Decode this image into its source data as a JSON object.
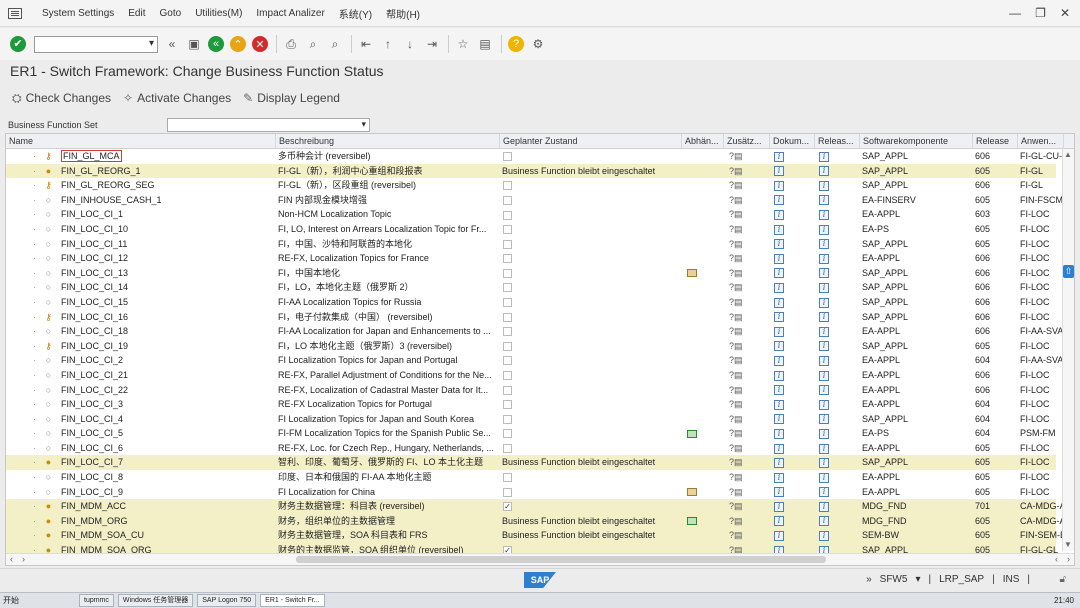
{
  "menu": {
    "items": [
      "System Settings",
      "Edit",
      "Goto",
      "Utilities(M)",
      "Impact Analizer",
      "系统(Y)",
      "帮助(H)"
    ]
  },
  "window_controls": [
    "—",
    "❐",
    "✕"
  ],
  "page_title": "ER1 - Switch Framework: Change Business Function Status",
  "app_toolbar": {
    "check_changes": "Check Changes",
    "activate_changes": "Activate Changes",
    "display_legend": "Display Legend"
  },
  "bfs": {
    "label": "Business Function Set",
    "value": ""
  },
  "columns": [
    "Name",
    "Beschreibung",
    "Geplanter Zustand",
    "Abhän...",
    "Zusätz...",
    "Dokum...",
    "Releas...",
    "Softwarekomponente",
    "Release",
    "Anwen..."
  ],
  "rows": [
    {
      "name": "FIN_GL_MCA",
      "status": "reversible",
      "desc": "多币种会计 (reversibel)",
      "state": "",
      "checked": false,
      "dep": "",
      "sw": "SAP_APPL",
      "release": "606",
      "appl": "FI-GL-CU-M",
      "hl": false,
      "selected": true
    },
    {
      "name": "FIN_GL_REORG_1",
      "status": "on",
      "desc": "FI-GL（新），利润中心重组和段报表",
      "state": "Business Function bleibt eingeschaltet",
      "checked": false,
      "dep": "",
      "sw": "SAP_APPL",
      "release": "605",
      "appl": "FI-GL",
      "hl": true
    },
    {
      "name": "FIN_GL_REORG_SEG",
      "status": "reversible",
      "desc": "FI-GL（新），区段重组 (reversibel)",
      "state": "",
      "checked": false,
      "dep": "",
      "sw": "SAP_APPL",
      "release": "606",
      "appl": "FI-GL",
      "hl": false
    },
    {
      "name": "FIN_INHOUSE_CASH_1",
      "status": "off",
      "desc": "FIN 内部现金模块增强",
      "state": "",
      "checked": false,
      "dep": "",
      "sw": "EA-FINSERV",
      "release": "605",
      "appl": "FIN-FSCM-",
      "hl": false
    },
    {
      "name": "FIN_LOC_CI_1",
      "status": "off",
      "desc": "Non-HCM Localization Topic",
      "state": "",
      "checked": false,
      "dep": "",
      "sw": "EA-APPL",
      "release": "603",
      "appl": "FI-LOC",
      "hl": false
    },
    {
      "name": "FIN_LOC_CI_10",
      "status": "off",
      "desc": "FI, LO, Interest on Arrears Localization Topic for Fr...",
      "state": "",
      "checked": false,
      "dep": "",
      "sw": "EA-PS",
      "release": "605",
      "appl": "FI-LOC",
      "hl": false
    },
    {
      "name": "FIN_LOC_CI_11",
      "status": "off",
      "desc": "FI，中国、沙特和阿联酋的本地化",
      "state": "",
      "checked": false,
      "dep": "",
      "sw": "SAP_APPL",
      "release": "605",
      "appl": "FI-LOC",
      "hl": false
    },
    {
      "name": "FIN_LOC_CI_12",
      "status": "off",
      "desc": "RE-FX, Localization Topics for France",
      "state": "",
      "checked": false,
      "dep": "",
      "sw": "EA-APPL",
      "release": "606",
      "appl": "FI-LOC",
      "hl": false
    },
    {
      "name": "FIN_LOC_CI_13",
      "status": "off",
      "desc": "FI，中国本地化",
      "state": "",
      "checked": false,
      "dep": "y",
      "sw": "SAP_APPL",
      "release": "606",
      "appl": "FI-LOC",
      "hl": false
    },
    {
      "name": "FIN_LOC_CI_14",
      "status": "off",
      "desc": "FI，LO，本地化主题（俄罗斯 2）",
      "state": "",
      "checked": false,
      "dep": "",
      "sw": "SAP_APPL",
      "release": "606",
      "appl": "FI-LOC",
      "hl": false
    },
    {
      "name": "FIN_LOC_CI_15",
      "status": "off",
      "desc": "FI-AA Localization Topics for Russia",
      "state": "",
      "checked": false,
      "dep": "",
      "sw": "SAP_APPL",
      "release": "606",
      "appl": "FI-LOC",
      "hl": false
    },
    {
      "name": "FIN_LOC_CI_16",
      "status": "reversible",
      "desc": "FI，电子付款集成（中国） (reversibel)",
      "state": "",
      "checked": false,
      "dep": "",
      "sw": "SAP_APPL",
      "release": "606",
      "appl": "FI-LOC",
      "hl": false
    },
    {
      "name": "FIN_LOC_CI_18",
      "status": "off",
      "desc": "FI-AA Localization for Japan and Enhancements to ...",
      "state": "",
      "checked": false,
      "dep": "",
      "sw": "EA-APPL",
      "release": "606",
      "appl": "FI-AA-SVA",
      "hl": false
    },
    {
      "name": "FIN_LOC_CI_19",
      "status": "reversible",
      "desc": "FI，LO 本地化主题（俄罗斯）3 (reversibel)",
      "state": "",
      "checked": false,
      "dep": "",
      "sw": "SAP_APPL",
      "release": "605",
      "appl": "FI-LOC",
      "hl": false
    },
    {
      "name": "FIN_LOC_CI_2",
      "status": "off",
      "desc": "FI Localization Topics for Japan and Portugal",
      "state": "",
      "checked": false,
      "dep": "",
      "sw": "EA-APPL",
      "release": "604",
      "appl": "FI-AA-SVA",
      "hl": false
    },
    {
      "name": "FIN_LOC_CI_21",
      "status": "off",
      "desc": "RE-FX, Parallel Adjustment of Conditions for the Ne...",
      "state": "",
      "checked": false,
      "dep": "",
      "sw": "EA-APPL",
      "release": "606",
      "appl": "FI-LOC",
      "hl": false
    },
    {
      "name": "FIN_LOC_CI_22",
      "status": "off",
      "desc": "RE-FX, Localization of Cadastral Master Data for It...",
      "state": "",
      "checked": false,
      "dep": "",
      "sw": "EA-APPL",
      "release": "606",
      "appl": "FI-LOC",
      "hl": false
    },
    {
      "name": "FIN_LOC_CI_3",
      "status": "off",
      "desc": "RE-FX Localization Topics for Portugal",
      "state": "",
      "checked": false,
      "dep": "",
      "sw": "EA-APPL",
      "release": "604",
      "appl": "FI-LOC",
      "hl": false
    },
    {
      "name": "FIN_LOC_CI_4",
      "status": "off",
      "desc": "FI Localization Topics for Japan and South Korea",
      "state": "",
      "checked": false,
      "dep": "",
      "sw": "SAP_APPL",
      "release": "604",
      "appl": "FI-LOC",
      "hl": false
    },
    {
      "name": "FIN_LOC_CI_5",
      "status": "off",
      "desc": "FI-FM Localization Topics for the Spanish Public Se...",
      "state": "",
      "checked": false,
      "dep": "g",
      "sw": "EA-PS",
      "release": "604",
      "appl": "PSM-FM",
      "hl": false
    },
    {
      "name": "FIN_LOC_CI_6",
      "status": "off",
      "desc": "RE-FX, Loc. for Czech Rep., Hungary, Netherlands, ...",
      "state": "",
      "checked": false,
      "dep": "",
      "sw": "EA-APPL",
      "release": "605",
      "appl": "FI-LOC",
      "hl": false
    },
    {
      "name": "FIN_LOC_CI_7",
      "status": "on",
      "desc": "智利、印度、葡萄牙、俄罗斯的 FI、LO 本土化主题",
      "state": "Business Function bleibt eingeschaltet",
      "checked": false,
      "dep": "",
      "sw": "SAP_APPL",
      "release": "605",
      "appl": "FI-LOC",
      "hl": true
    },
    {
      "name": "FIN_LOC_CI_8",
      "status": "off",
      "desc": "印度、日本和俄国的 FI-AA 本地化主题",
      "state": "",
      "checked": false,
      "dep": "",
      "sw": "EA-APPL",
      "release": "605",
      "appl": "FI-LOC",
      "hl": false
    },
    {
      "name": "FIN_LOC_CI_9",
      "status": "off",
      "desc": "FI Localization for China",
      "state": "",
      "checked": false,
      "dep": "y",
      "sw": "EA-APPL",
      "release": "605",
      "appl": "FI-LOC",
      "hl": false
    },
    {
      "name": "FIN_MDM_ACC",
      "status": "on",
      "desc": "财务主数据管理：科目表 (reversibel)",
      "state": "",
      "checked": true,
      "dep": "",
      "sw": "MDG_FND",
      "release": "701",
      "appl": "CA-MDG-A",
      "hl": true
    },
    {
      "name": "FIN_MDM_ORG",
      "status": "on",
      "desc": "财务，组织单位的主数据管理",
      "state": "Business Function bleibt eingeschaltet",
      "checked": false,
      "dep": "g",
      "sw": "MDG_FND",
      "release": "605",
      "appl": "CA-MDG-A",
      "hl": true
    },
    {
      "name": "FIN_MDM_SOA_CU",
      "status": "on",
      "desc": "财务主数据管理，SOA 科目表和 FRS",
      "state": "Business Function bleibt eingeschaltet",
      "checked": false,
      "dep": "",
      "sw": "SEM-BW",
      "release": "605",
      "appl": "FIN-SEM-B",
      "hl": true
    },
    {
      "name": "FIN_MDM_SOA_ORG",
      "status": "on",
      "desc": "财务的主数据监管，SOA 组织单位 (reversibel)",
      "state": "",
      "checked": true,
      "dep": "",
      "sw": "SAP_APPL",
      "release": "605",
      "appl": "FI-GL-GL",
      "hl": true
    }
  ],
  "statusbar": {
    "brand": "SAP",
    "session": "SFW5",
    "server": "LRP_SAP",
    "mode": "INS"
  },
  "taskbar": {
    "start": "开始",
    "buttons": [
      "tupmmc",
      "Windows 任务管理器",
      "SAP Logon 750",
      "ER1 - Switch Fr..."
    ],
    "clock": "21:40"
  }
}
